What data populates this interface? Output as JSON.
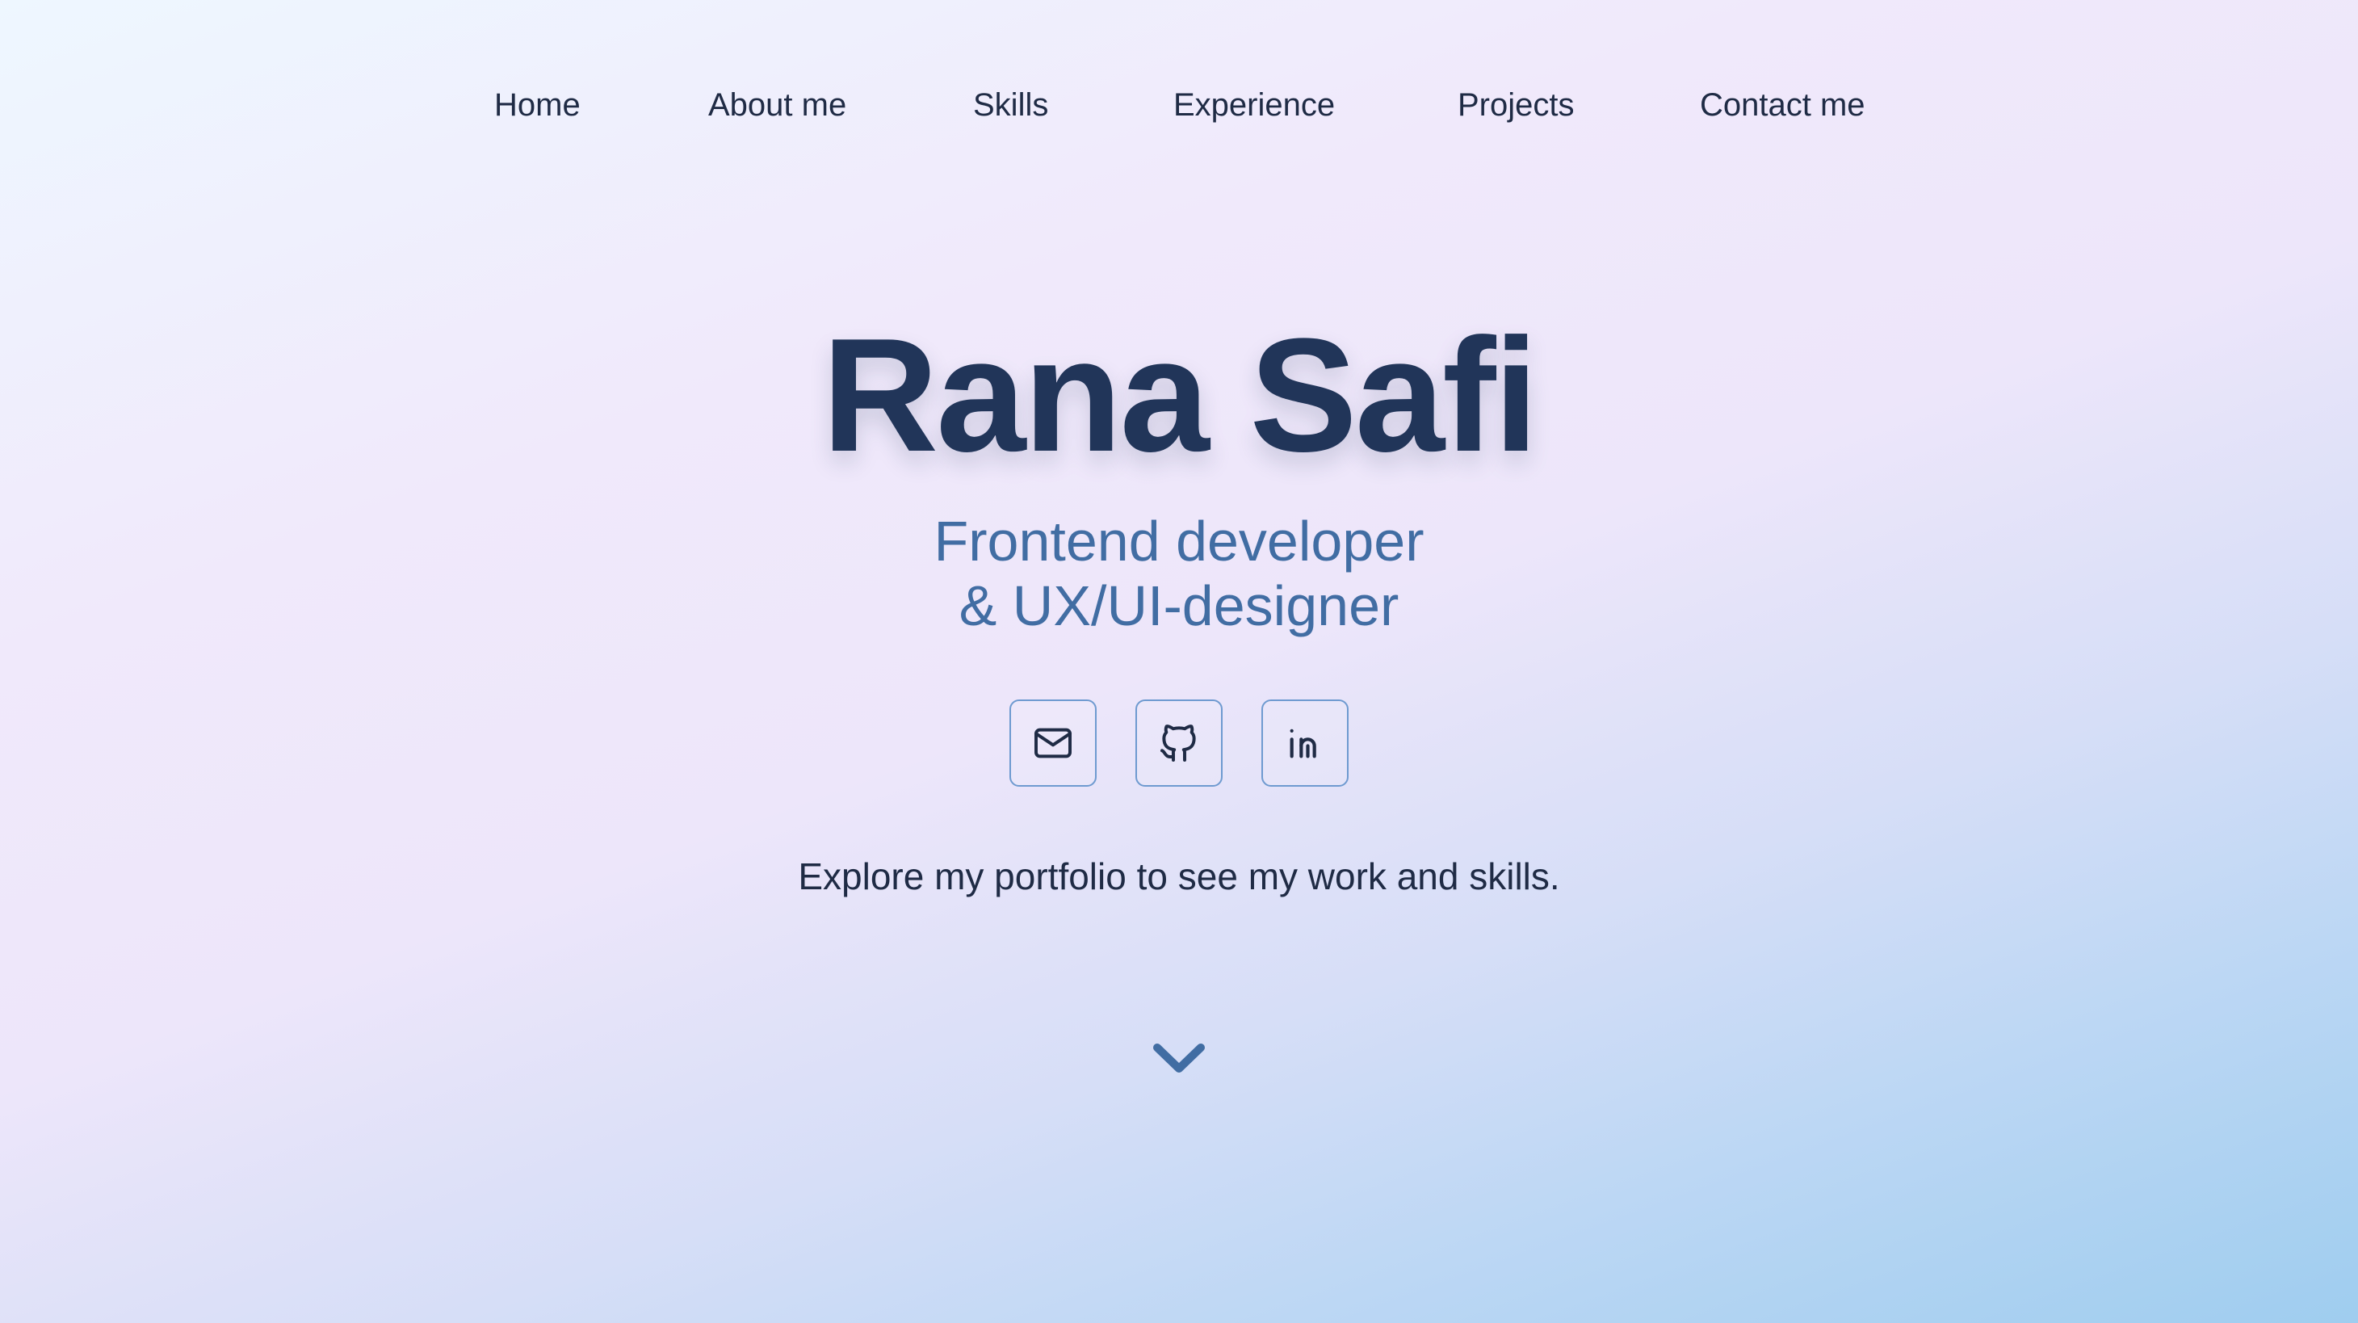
{
  "nav": {
    "items": [
      {
        "label": "Home"
      },
      {
        "label": "About me"
      },
      {
        "label": "Skills"
      },
      {
        "label": "Experience"
      },
      {
        "label": "Projects"
      },
      {
        "label": "Contact me"
      }
    ]
  },
  "hero": {
    "name": "Rana Safi",
    "subtitle_line1": "Frontend developer",
    "subtitle_line2": "& UX/UI-designer",
    "tagline": "Explore my portfolio to see my work and skills."
  },
  "socials": [
    {
      "icon": "mail-icon"
    },
    {
      "icon": "github-icon"
    },
    {
      "icon": "linkedin-icon"
    }
  ],
  "colors": {
    "heading": "#213559",
    "accent": "#416da3",
    "text": "#1f2b45",
    "icon_border": "#6e9ad0"
  }
}
